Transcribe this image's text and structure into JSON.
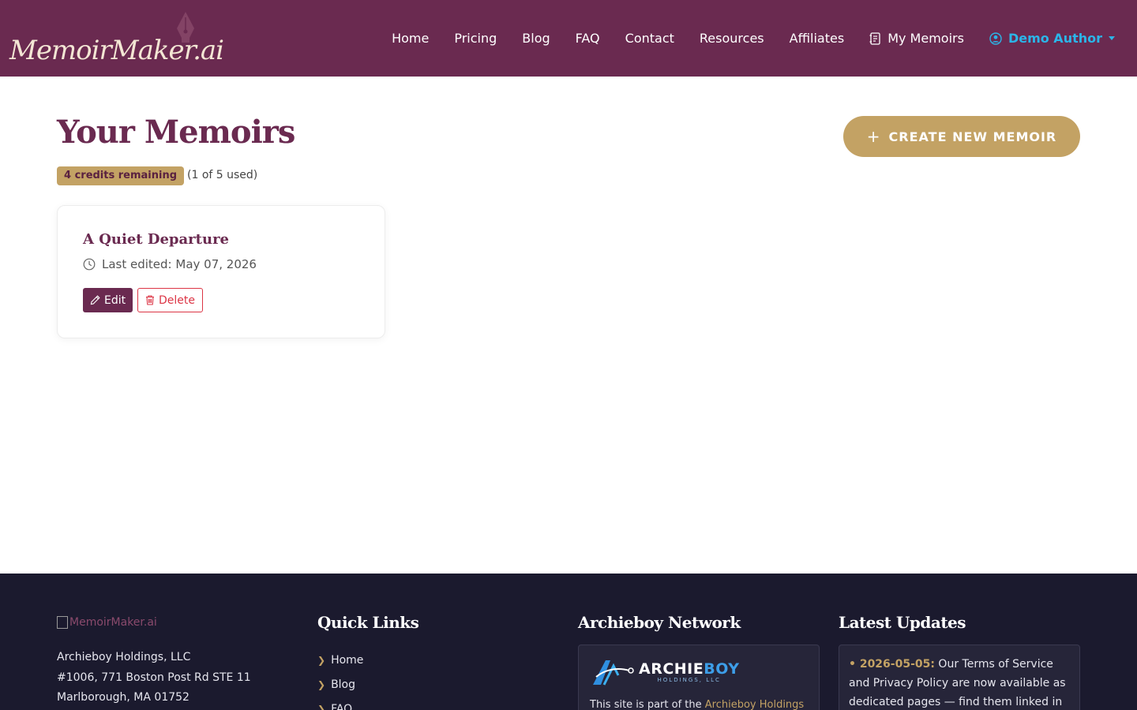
{
  "header": {
    "logo_text": "MemoirMaker.ai",
    "nav": [
      {
        "label": "Home"
      },
      {
        "label": "Pricing"
      },
      {
        "label": "Blog"
      },
      {
        "label": "FAQ"
      },
      {
        "label": "Contact"
      },
      {
        "label": "Resources"
      },
      {
        "label": "Affiliates"
      }
    ],
    "my_memoirs": "My Memoirs",
    "user_name": "Demo Author"
  },
  "main": {
    "title": "Your Memoirs",
    "create_button": "CREATE NEW MEMOIR",
    "credits_badge": "4 credits remaining",
    "credits_used": "(1 of 5 used)",
    "memoirs": [
      {
        "title": "A Quiet Departure",
        "last_edited": "Last edited: May 07, 2026",
        "edit_label": "Edit",
        "delete_label": "Delete"
      }
    ]
  },
  "footer": {
    "logo_alt": "MemoirMaker.ai",
    "address": [
      "Archieboy Holdings, LLC",
      "#1006, 771 Boston Post Rd STE 11",
      "Marlborough, MA 01752"
    ],
    "quick_links_title": "Quick Links",
    "quick_links": [
      "Home",
      "Blog",
      "FAQ"
    ],
    "network_title": "Archieboy Network",
    "network_logo_main": "ARCHIE",
    "network_logo_accent": "BOY",
    "network_logo_sub": "HOLDINGS, LLC",
    "network_text": "This site is part of the ",
    "network_link": "Archieboy Holdings",
    "updates_title": "Latest Updates",
    "update_date": "• 2026-05-05:",
    "update_text": " Our Terms of Service and Privacy Policy are now available as dedicated pages — find them linked in the"
  },
  "colors": {
    "header_bg": "#6a2a50",
    "accent_gold": "#c3a264",
    "footer_bg": "#1b1a2e",
    "user_link": "#2bb5e8",
    "danger": "#dc3545"
  }
}
